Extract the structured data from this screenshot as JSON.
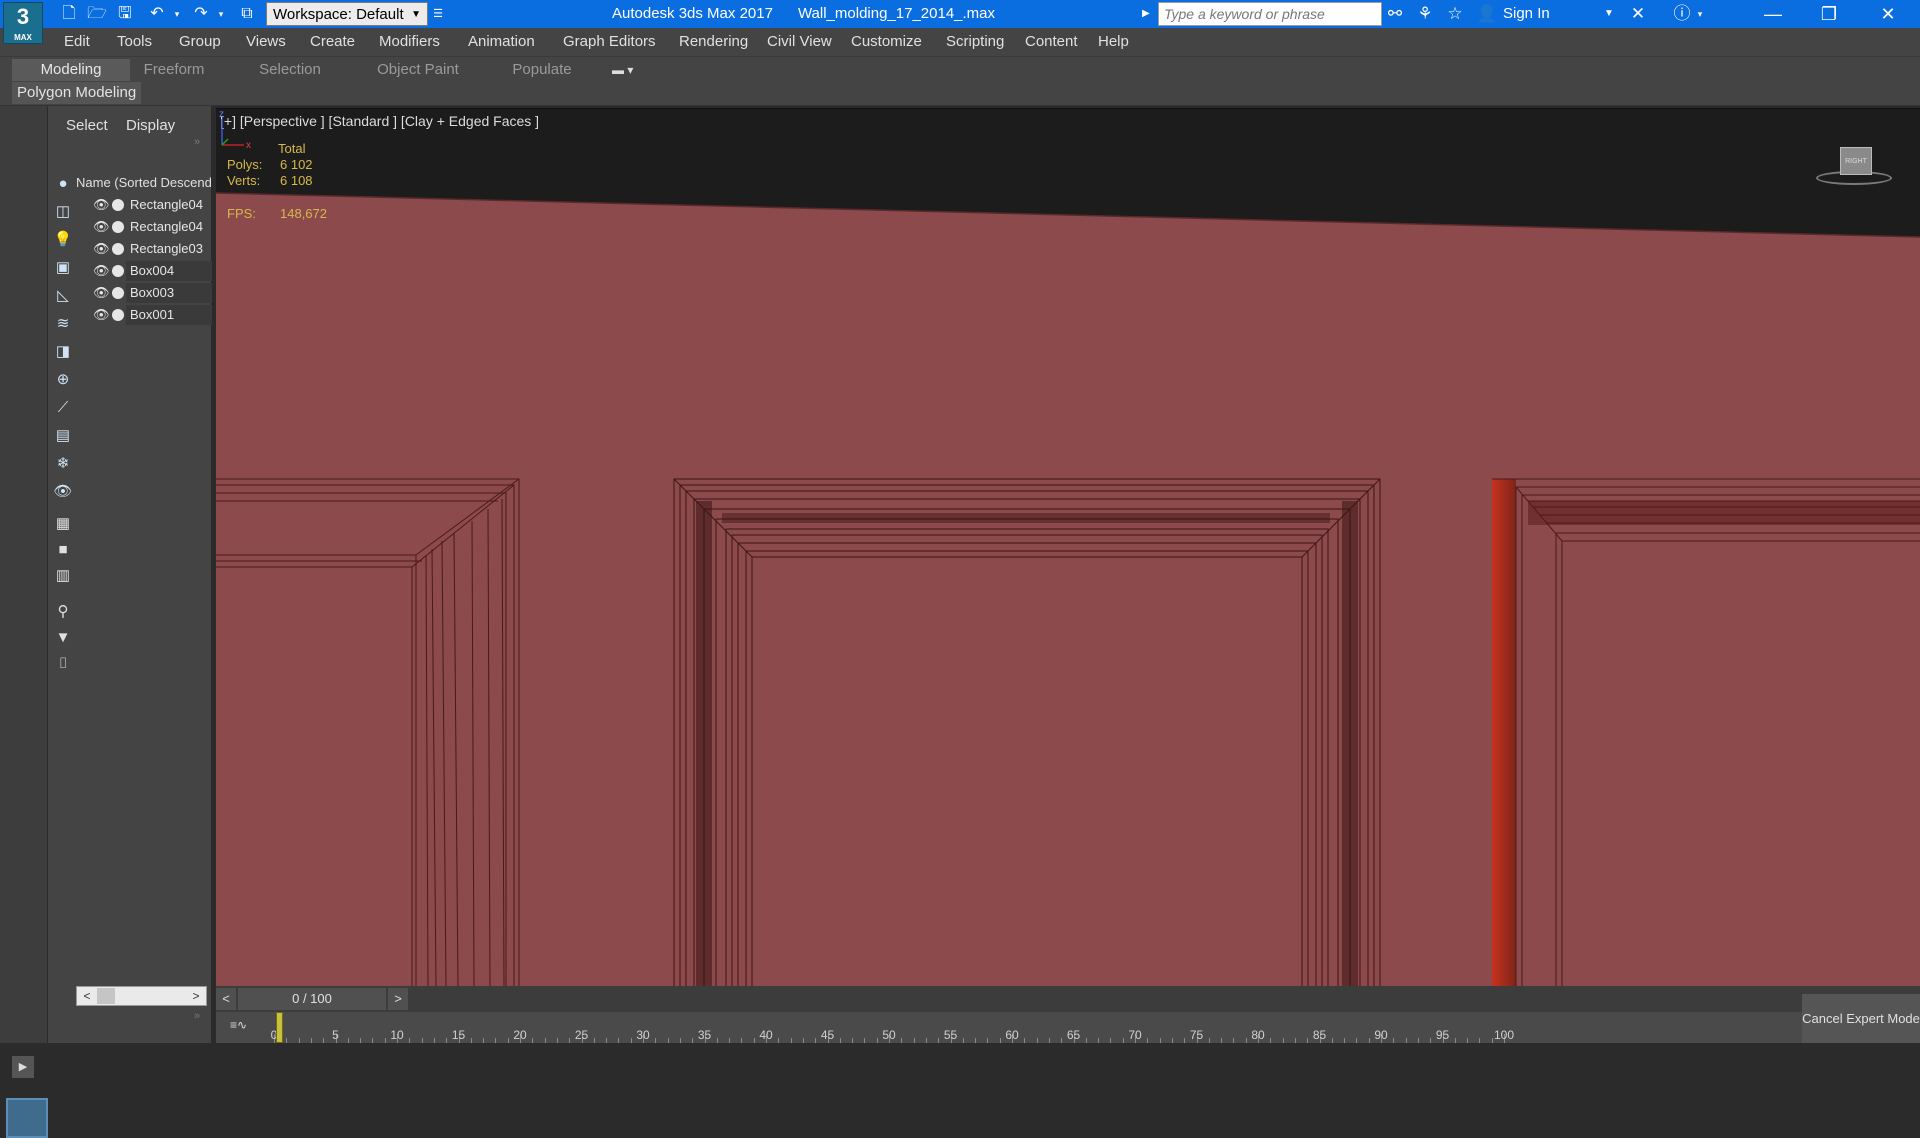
{
  "titlebar": {
    "logo_text": "3",
    "logo_sub": "MAX",
    "workspace": "Workspace: Default",
    "app_name": "Autodesk 3ds Max 2017",
    "file_name": "Wall_molding_17_2014_.max",
    "search_placeholder": "Type a keyword or phrase",
    "sign_in": "Sign In"
  },
  "menu": [
    "Edit",
    "Tools",
    "Group",
    "Views",
    "Create",
    "Modifiers",
    "Animation",
    "Graph Editors",
    "Rendering",
    "Civil View",
    "Customize",
    "Scripting",
    "Content",
    "Help"
  ],
  "ribbon": {
    "tabs": [
      "Modeling",
      "Freeform",
      "Selection",
      "Object Paint",
      "Populate"
    ],
    "active_tab": "Modeling",
    "panel_label": "Polygon Modeling"
  },
  "scene_explorer": {
    "tabs": [
      "Select",
      "Display"
    ],
    "column_header": "Name (Sorted Descending)",
    "items": [
      {
        "name": "Rectangle04",
        "selected": false
      },
      {
        "name": "Rectangle04",
        "selected": false
      },
      {
        "name": "Rectangle03",
        "selected": false
      },
      {
        "name": "Box004",
        "selected": true
      },
      {
        "name": "Box003",
        "selected": true
      },
      {
        "name": "Box001",
        "selected": true
      }
    ]
  },
  "viewport": {
    "label": "[+] [Perspective ] [Standard ] [Clay + Edged Faces ]",
    "stats": {
      "header": "Total",
      "polys_label": "Polys:",
      "polys_value": "6 102",
      "verts_label": "Verts:",
      "verts_value": "6 108",
      "fps_label": "FPS:",
      "fps_value": "148,672"
    },
    "viewcube_label": "RIGHT",
    "axis_z": "z",
    "axis_x": "x",
    "colors": {
      "wall": "#8c4a4c",
      "background": "#1c1c1c",
      "molding_dark": "#4a1a1a",
      "accent_red": "#b02a1e"
    }
  },
  "timeline": {
    "frame_display": "0 / 100",
    "prev": "<",
    "next": ">",
    "ticks": [
      0,
      5,
      10,
      15,
      20,
      25,
      30,
      35,
      40,
      45,
      50,
      55,
      60,
      65,
      70,
      75,
      80,
      85,
      90,
      95,
      100
    ],
    "current_frame": 0,
    "cancel_expert": "Cancel Expert Mode"
  }
}
